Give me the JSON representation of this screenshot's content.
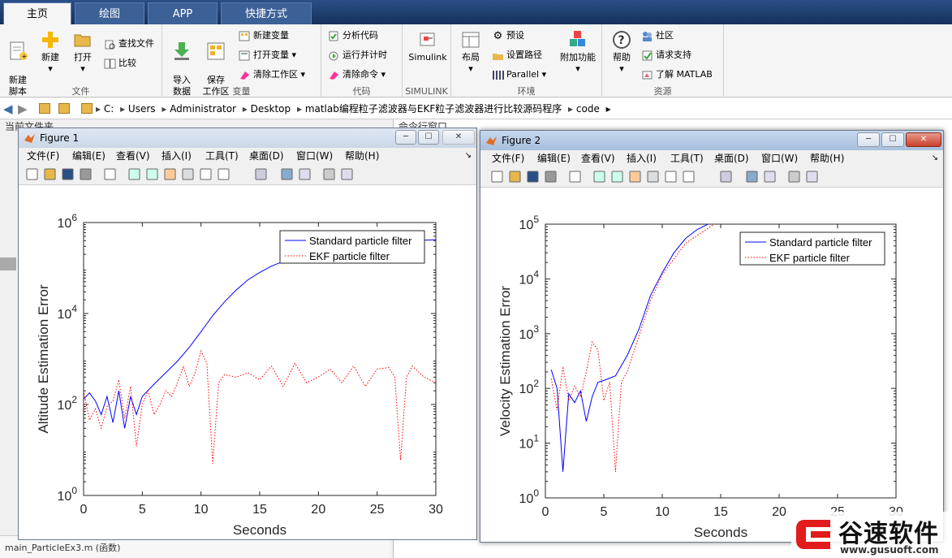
{
  "ribbon": {
    "tabs": [
      {
        "label": "主页"
      },
      {
        "label": "绘图"
      },
      {
        "label": "APP"
      },
      {
        "label": "快捷方式"
      }
    ],
    "file": {
      "label": "文件",
      "new_script": "新建\n脚本",
      "new": "新建",
      "open": "打开",
      "find_files": "查找文件",
      "compare": "比较"
    },
    "variable": {
      "label": "变量",
      "import_data": "导入\n数据",
      "save_workspace": "保存\n工作区",
      "new_variable": "新建变量",
      "open_variable": "打开变量",
      "clear_workspace": "清除工作区"
    },
    "code": {
      "label": "代码",
      "analyze_code": "分析代码",
      "run_and_time": "运行并计时",
      "clear_commands": "清除命令"
    },
    "simulink": {
      "label": "SIMULINK",
      "simulink": "Simulink"
    },
    "environment": {
      "label": "环境",
      "layout": "布局",
      "preferences": "预设",
      "set_path": "设置路径",
      "parallel": "Parallel",
      "addons": "附加功能"
    },
    "resources": {
      "label": "资源",
      "help": "帮助",
      "community": "社区",
      "request_support": "请求支持",
      "learn_matlab": "了解 MATLAB"
    }
  },
  "address": {
    "segments": [
      "C:",
      "Users",
      "Administrator",
      "Desktop",
      "matlab编程粒子滤波器与EKF粒子滤波器进行比较源码程序",
      "code"
    ]
  },
  "panels": {
    "current_folder": "当前文件夹",
    "command_window": "命令行窗口",
    "bottom_file": "main_ParticleEx3.m  (函数)"
  },
  "figure_menu": [
    "文件(F)",
    "编辑(E)",
    "查看(V)",
    "插入(I)",
    "工具(T)",
    "桌面(D)",
    "窗口(W)",
    "帮助(H)"
  ],
  "figures": [
    {
      "title": "Figure 1",
      "ylabel": "Altitude Estimation Error",
      "xlabel": "Seconds",
      "legend": [
        "Standard particle filter",
        "EKF particle filter"
      ],
      "x_ticks": [
        "0",
        "5",
        "10",
        "15",
        "20",
        "25",
        "30"
      ],
      "y_ticks": [
        {
          "base": "10",
          "exp": "0"
        },
        {
          "base": "10",
          "exp": "2"
        },
        {
          "base": "10",
          "exp": "4"
        },
        {
          "base": "10",
          "exp": "6"
        }
      ]
    },
    {
      "title": "Figure 2",
      "ylabel": "Velocity Estimation Error",
      "xlabel": "Seconds",
      "legend": [
        "Standard particle filter",
        "EKF particle filter"
      ],
      "x_ticks": [
        "0",
        "5",
        "10",
        "15",
        "20",
        "25",
        "30"
      ],
      "y_ticks": [
        {
          "base": "10",
          "exp": "0"
        },
        {
          "base": "10",
          "exp": "1"
        },
        {
          "base": "10",
          "exp": "2"
        },
        {
          "base": "10",
          "exp": "3"
        },
        {
          "base": "10",
          "exp": "4"
        },
        {
          "base": "10",
          "exp": "5"
        }
      ]
    }
  ],
  "chart_data": [
    {
      "type": "line",
      "title": "",
      "xlabel": "Seconds",
      "ylabel": "Altitude Estimation Error",
      "yscale": "log",
      "xlim": [
        0,
        30
      ],
      "ylim": [
        1,
        1000000
      ],
      "legend_placement": "top-right",
      "series": [
        {
          "name": "Standard particle filter",
          "color": "#0000ff",
          "style": "solid",
          "x": [
            0,
            0.5,
            1,
            1.5,
            2,
            2.5,
            3,
            3.5,
            4,
            4.5,
            5,
            6,
            7,
            8,
            9,
            10,
            11,
            12,
            13,
            14,
            15,
            16,
            17,
            18,
            19,
            20,
            22,
            24,
            26,
            28,
            30
          ],
          "y": [
            130,
            180,
            120,
            60,
            150,
            40,
            200,
            30,
            150,
            60,
            150,
            280,
            500,
            900,
            1800,
            4000,
            9000,
            18000,
            33000,
            55000,
            80000,
            110000,
            140000,
            170000,
            200000,
            230000,
            280000,
            320000,
            360000,
            400000,
            420000
          ]
        },
        {
          "name": "EKF particle filter",
          "color": "#ff0000",
          "style": "dotted",
          "x": [
            0,
            0.5,
            1,
            1.5,
            2,
            2.5,
            3,
            3.5,
            4,
            4.5,
            5,
            5.5,
            6,
            6.5,
            7,
            7.5,
            8,
            8.5,
            9,
            9.5,
            10,
            10.5,
            11,
            11.5,
            12,
            13,
            14,
            15,
            16,
            17,
            18,
            19,
            20,
            21,
            22,
            23,
            24,
            25,
            26,
            26.5,
            27,
            27.5,
            28,
            29,
            30
          ],
          "y": [
            200,
            45,
            80,
            30,
            90,
            120,
            350,
            50,
            250,
            12,
            100,
            200,
            60,
            100,
            200,
            150,
            300,
            700,
            250,
            500,
            1500,
            800,
            5,
            300,
            450,
            400,
            500,
            350,
            700,
            250,
            800,
            300,
            400,
            600,
            300,
            700,
            250,
            600,
            650,
            400,
            6,
            400,
            700,
            400,
            300
          ]
        }
      ]
    },
    {
      "type": "line",
      "title": "",
      "xlabel": "Seconds",
      "ylabel": "Velocity Estimation Error",
      "yscale": "log",
      "xlim": [
        0,
        30
      ],
      "ylim": [
        1,
        100000
      ],
      "legend_placement": "top-right",
      "series": [
        {
          "name": "Standard particle filter",
          "color": "#0000ff",
          "style": "solid",
          "x": [
            0.5,
            1,
            1.5,
            2,
            2.5,
            3,
            3.5,
            4,
            4.5,
            5,
            6,
            7,
            8,
            9,
            10,
            11,
            12,
            13,
            15,
            17,
            20,
            25,
            30
          ],
          "y": [
            220,
            100,
            3,
            80,
            55,
            90,
            25,
            70,
            130,
            140,
            170,
            400,
            1200,
            5000,
            13000,
            30000,
            55000,
            80000,
            130000,
            160000,
            180000,
            200000,
            200000
          ]
        },
        {
          "name": "EKF particle filter",
          "color": "#ff0000",
          "style": "dotted",
          "x": [
            0.5,
            1,
            1.5,
            2,
            2.5,
            3,
            3.5,
            4,
            4.5,
            5,
            5.5,
            6,
            6.5,
            7,
            8,
            9,
            10,
            12,
            15,
            20,
            25,
            30
          ],
          "y": [
            150,
            40,
            250,
            60,
            110,
            70,
            200,
            700,
            500,
            60,
            130,
            3,
            130,
            200,
            900,
            4000,
            12000,
            45000,
            120000,
            170000,
            190000,
            200000
          ]
        }
      ]
    }
  ],
  "watermark": {
    "text": "谷速软件",
    "url": "www.gusuoft.com"
  },
  "colors": {
    "accent": "#1b3a6a",
    "ribbon_bg": "#f5f5f5",
    "blue": "#0000ff",
    "red": "#ff0000"
  }
}
